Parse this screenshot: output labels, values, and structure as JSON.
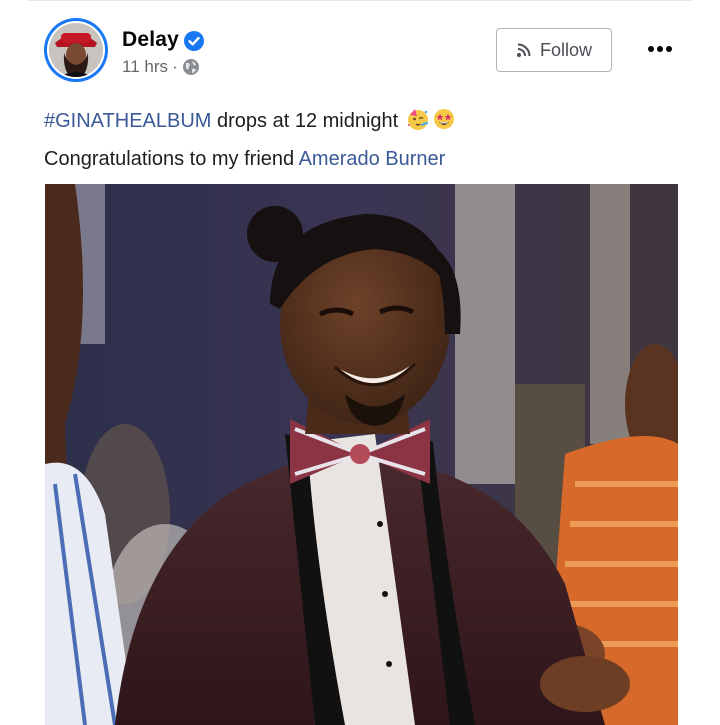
{
  "post": {
    "author": "Delay",
    "time": "11 hrs",
    "separator": "·",
    "follow_label": "Follow",
    "text_line1": {
      "hashtag": "#GINATHEALBUM",
      "rest": " drops at 12 midnight "
    },
    "text_line2": {
      "prefix": "Congratulations to my friend ",
      "mention": "Amerado Burner"
    }
  },
  "icons": {
    "verified": "verified-badge-icon",
    "audience": "globe-icon",
    "follow": "rss-icon",
    "more": "more-dots-icon",
    "emojis": [
      "partying-face-emoji",
      "star-struck-emoji"
    ]
  },
  "colors": {
    "link": "#3b5998",
    "verified": "#1877f2",
    "meta": "#65676b"
  }
}
